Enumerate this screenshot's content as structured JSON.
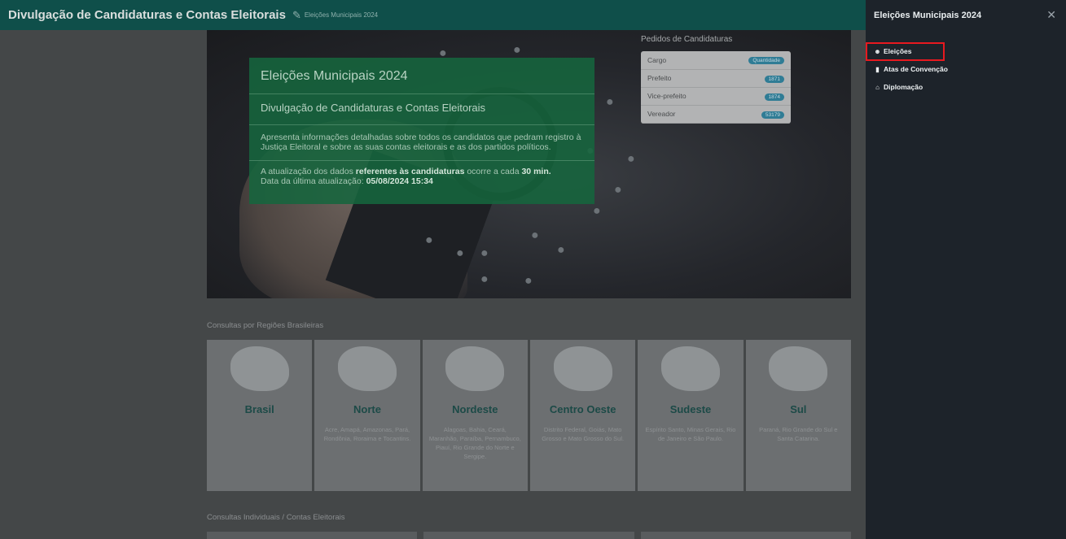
{
  "header": {
    "title": "Divulgação de Candidaturas e Contas Eleitorais",
    "subtitle": "Eleições Municipais 2024",
    "edit_icon": "edit-icon"
  },
  "hero": {
    "heading": "Eleições Municipais 2024",
    "subheading": "Divulgação de Candidaturas e Contas Eleitorais",
    "description": "Apresenta informações detalhadas sobre todos os candidatos que pedram registro à Justiça Eleitoral e sobre as suas contas eleitorais e as dos partidos políticos.",
    "update_prefix": "A atualização dos dados ",
    "update_bold": "referentes às candidaturas",
    "update_mid": " ocorre a cada ",
    "update_interval": "30 min.",
    "last_update_label": "Data da última atualização: ",
    "last_update_value": "05/08/2024 15:34"
  },
  "pedidos": {
    "title": "Pedidos de Candidaturas",
    "header": {
      "cargo": "Cargo",
      "quantidade": "Quantidade"
    },
    "rows": [
      {
        "cargo": "Prefeito",
        "quantidade": "1871"
      },
      {
        "cargo": "Vice-prefeito",
        "quantidade": "1874"
      },
      {
        "cargo": "Vereador",
        "quantidade": "53179"
      }
    ]
  },
  "regions_section": {
    "title": "Consultas por Regiões Brasileiras",
    "regions": [
      {
        "name": "Brasil",
        "states": ""
      },
      {
        "name": "Norte",
        "states": "Acre, Amapá, Amazonas, Pará, Rondônia, Roraima e Tocantins."
      },
      {
        "name": "Nordeste",
        "states": "Alagoas, Bahia, Ceará, Maranhão, Paraíba, Pernambuco, Piauí, Rio Grande do Norte e Sergipe."
      },
      {
        "name": "Centro Oeste",
        "states": "Distrito Federal, Goiás, Mato Grosso e Mato Grosso do Sul."
      },
      {
        "name": "Sudeste",
        "states": "Espírito Santo, Minas Gerais, Rio de Janeiro e São Paulo."
      },
      {
        "name": "Sul",
        "states": "Paraná, Rio Grande do Sul e Santa Catarina."
      }
    ]
  },
  "individual_section": {
    "title": "Consultas Individuais / Contas Eleitorais"
  },
  "drawer": {
    "title": "Eleições Municipais 2024",
    "close_icon": "close-icon",
    "items": [
      {
        "label": "Eleições",
        "icon": "people-icon"
      },
      {
        "label": "Atas de Convenção",
        "icon": "document-icon"
      },
      {
        "label": "Diplomação",
        "icon": "institution-icon"
      }
    ]
  },
  "colors": {
    "header_bg": "#0f4f4a",
    "drawer_bg": "#1d232a",
    "highlight": "#e8191f",
    "info_box": "#16653e",
    "badge": "#2f7c95"
  }
}
